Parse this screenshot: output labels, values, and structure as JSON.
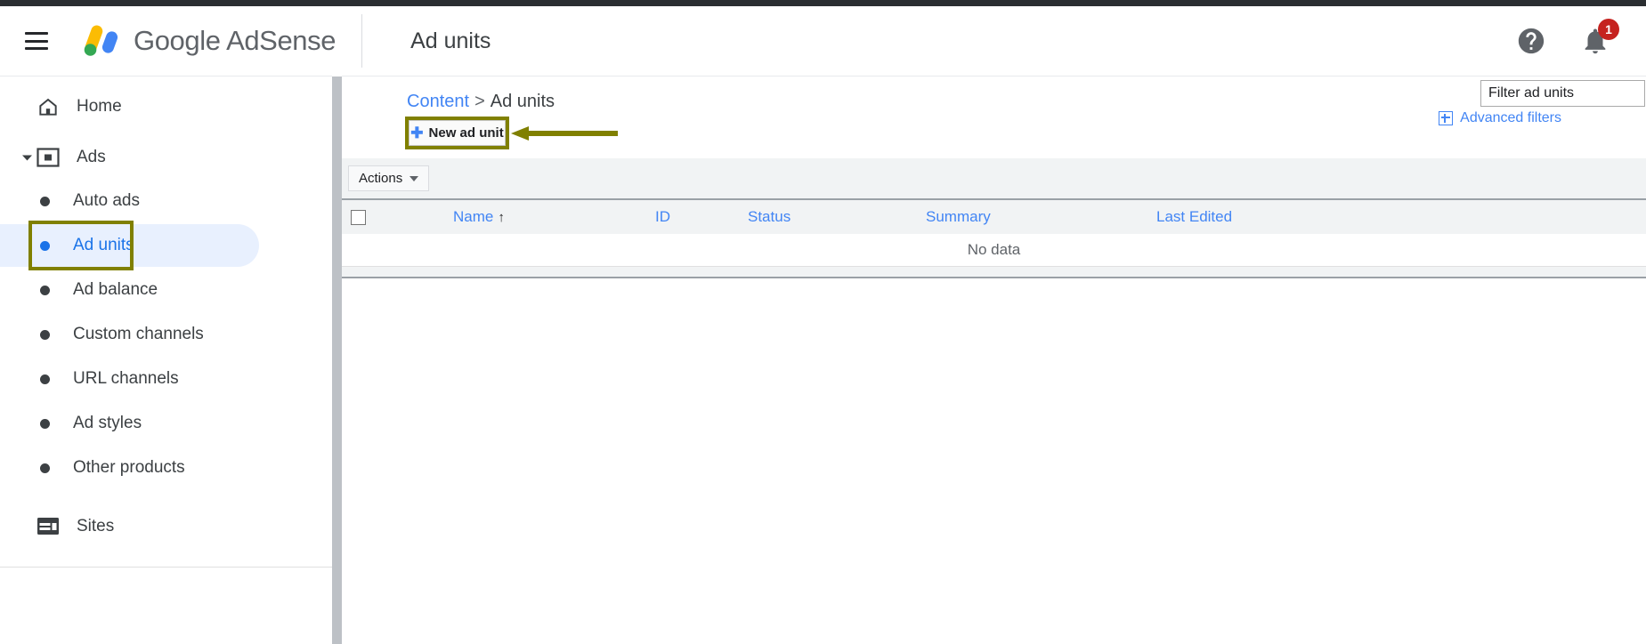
{
  "header": {
    "menu_icon": "hamburger-menu-icon",
    "brand_name": "Google AdSense",
    "page_title": "Ad units",
    "help_icon": "help-icon",
    "notifications_icon": "notifications-bell-icon",
    "notification_count": "1"
  },
  "sidebar": {
    "items": [
      {
        "label": "Home",
        "icon": "home-icon"
      },
      {
        "label": "Ads",
        "icon": "ads-icon",
        "expanded": true
      },
      {
        "label": "Sites",
        "icon": "sites-icon"
      }
    ],
    "ads_children": [
      {
        "label": "Auto ads",
        "selected": false
      },
      {
        "label": "Ad units",
        "selected": true
      },
      {
        "label": "Ad balance",
        "selected": false
      },
      {
        "label": "Custom channels",
        "selected": false
      },
      {
        "label": "URL channels",
        "selected": false
      },
      {
        "label": "Ad styles",
        "selected": false
      },
      {
        "label": "Other products",
        "selected": false
      }
    ]
  },
  "content": {
    "breadcrumb": {
      "parent": "Content",
      "separator": ">",
      "current": "Ad units"
    },
    "new_ad_unit_button": {
      "label": "New ad unit",
      "plus_icon": "plus-icon"
    },
    "filter": {
      "value": "Filter ad units",
      "placeholder": "Filter ad units"
    },
    "advanced_filters": {
      "label": "Advanced filters",
      "icon": "plus-box-icon"
    },
    "toolbar": {
      "actions_label": "Actions",
      "caret_icon": "chevron-down-icon"
    },
    "table": {
      "columns": [
        {
          "label": "Name",
          "sorted": true,
          "sort_arrow": "↑"
        },
        {
          "label": "ID",
          "sorted": false
        },
        {
          "label": "Status",
          "sorted": false
        },
        {
          "label": "Summary",
          "sorted": false
        },
        {
          "label": "Last Edited",
          "sorted": false
        }
      ],
      "rows": [],
      "empty_message": "No data"
    }
  },
  "annotations": {
    "color": "#808000",
    "highlight_button": "New ad unit",
    "highlight_nav_item": "Ad units",
    "arrow_direction": "left"
  }
}
